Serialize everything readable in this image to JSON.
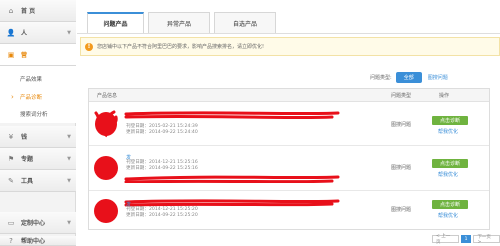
{
  "sidebar": {
    "items": [
      {
        "icon": "home-icon",
        "label": "首 页"
      },
      {
        "icon": "user-icon",
        "label": "人"
      },
      {
        "icon": "gift-icon",
        "label": "营"
      },
      {
        "icon": "yen-icon",
        "label": "钱"
      },
      {
        "icon": "flag-icon",
        "label": "专题"
      },
      {
        "icon": "wrench-icon",
        "label": "工具"
      },
      {
        "icon": "monitor-icon",
        "label": "定制中心"
      },
      {
        "icon": "help-icon",
        "label": "帮助中心"
      }
    ],
    "subitems": [
      "产品效果",
      "产品诊断",
      "搜索词分析"
    ]
  },
  "tabs": [
    "问题产品",
    "异常产品",
    "自选产品"
  ],
  "notice": "您店铺中以下产品不符合阿里巴巴的要求，影响产品搜索排名，请立即优化!",
  "filter": {
    "label": "问题类型:",
    "all": "全部",
    "link": "图搜问题"
  },
  "table": {
    "headers": [
      "产品信息",
      "问题类型",
      "操作"
    ],
    "rows": [
      {
        "name": "",
        "post_date": "刊登日期：2015-02-21 15:24:39",
        "update_date": "更新日期：2014-09-22 15:24:40",
        "type": "图搜问题",
        "action": "点击诊断",
        "link": "帮我优化"
      },
      {
        "name": "发",
        "post_date": "刊登日期：2014-12-21 15:25:16",
        "update_date": "更新日期：2014-09-22 15:25:16",
        "type": "图搜问题",
        "action": "点击诊断",
        "link": "帮我优化"
      },
      {
        "name": "发",
        "post_date": "刊登日期：2014-12-21 15:25:20",
        "update_date": "更新日期：2014-09-22 15:25:20",
        "type": "图搜问题",
        "action": "点击诊断",
        "link": "帮我优化"
      }
    ]
  },
  "pager": {
    "prev": "< 上一页",
    "current": "1",
    "next": "下一页 >"
  },
  "colors": {
    "accent": "#3b8fd8",
    "active": "#e8890c",
    "success": "#6fb33f",
    "redact": "#e8101a"
  }
}
